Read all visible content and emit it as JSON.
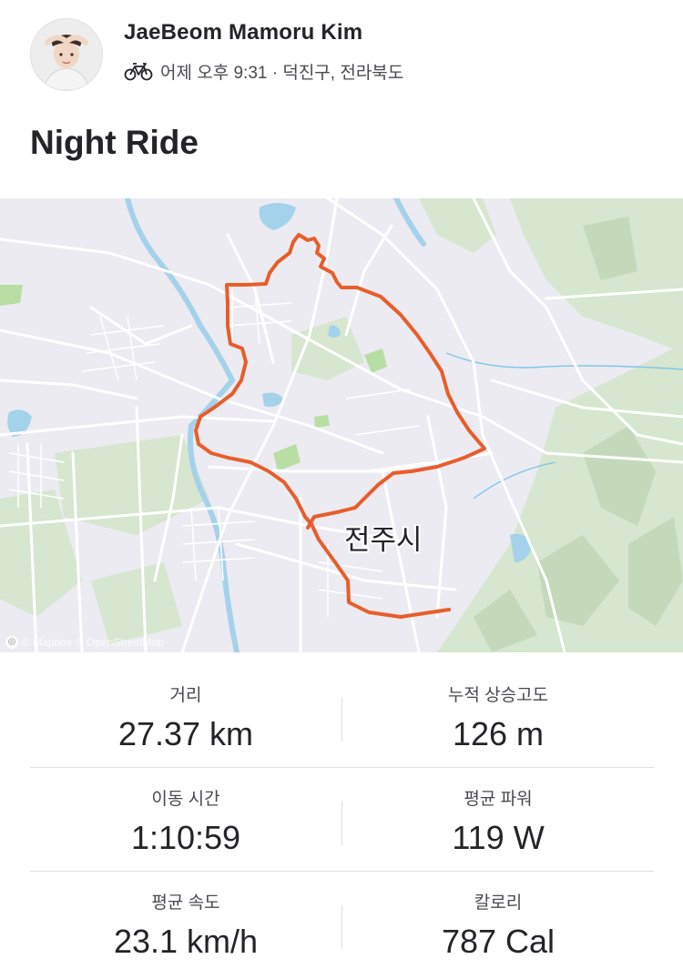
{
  "activity": {
    "athlete_name": "JaeBeom Mamoru Kim",
    "sport_icon": "bike-icon",
    "meta": "어제 오후 9:31 · 덕진구, 전라북도",
    "title": "Night Ride"
  },
  "map": {
    "city_label": "전주시",
    "attribution_mapbox": "© Mapbox",
    "attribution_osm": "© OpenStreetMap",
    "route_color": "#e85d2a"
  },
  "stats": [
    {
      "label": "거리",
      "value": "27.37 km"
    },
    {
      "label": "누적 상승고도",
      "value": "126 m"
    },
    {
      "label": "이동 시간",
      "value": "1:10:59"
    },
    {
      "label": "평균 파워",
      "value": "119 W"
    },
    {
      "label": "평균 속도",
      "value": "23.1 km/h"
    },
    {
      "label": "칼로리",
      "value": "787 Cal"
    }
  ]
}
